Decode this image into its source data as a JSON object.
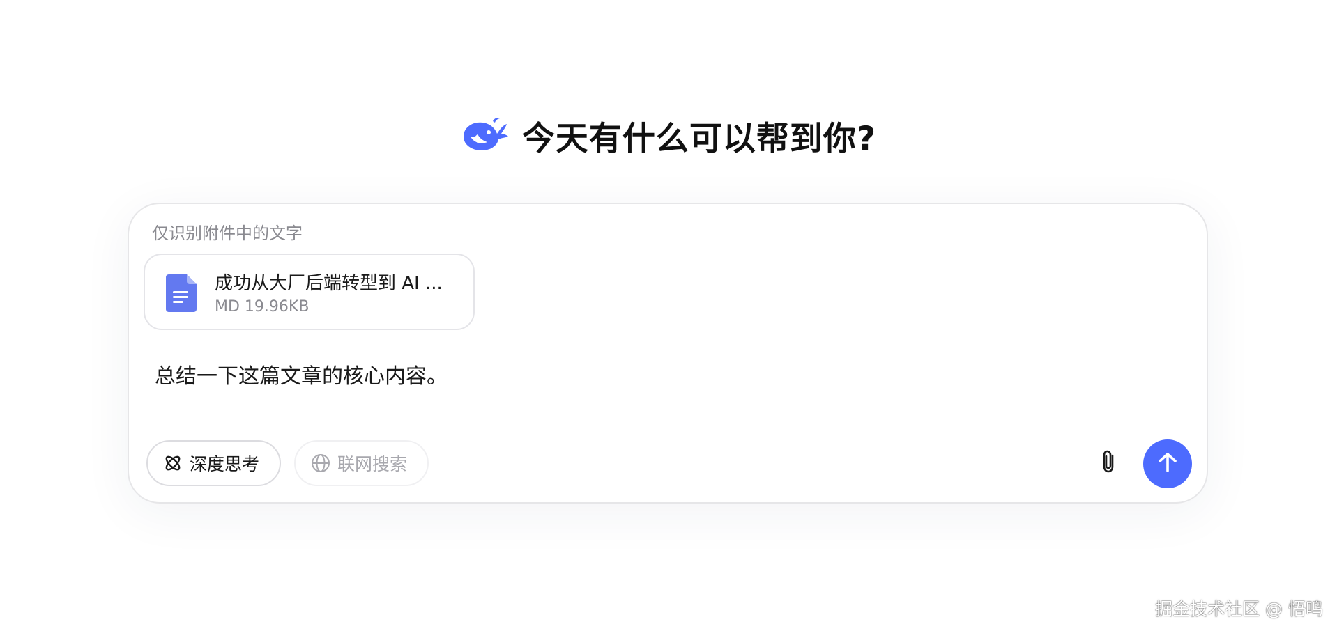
{
  "heading": {
    "title": "今天有什么可以帮到你?",
    "logo_icon": "deepseek-whale-logo"
  },
  "composer": {
    "hint": "仅识别附件中的文字",
    "attachment": {
      "icon": "document-icon",
      "name": "成功从大厂后端转型到 AI ...",
      "meta": "MD 19.96KB"
    },
    "prompt": "总结一下这篇文章的核心内容。",
    "toggles": {
      "deep_think": {
        "label": "深度思考",
        "icon": "atom-icon",
        "active": true
      },
      "web_search": {
        "label": "联网搜索",
        "icon": "globe-icon",
        "active": false
      }
    },
    "attach_icon": "paperclip-icon",
    "send_icon": "arrow-up-icon"
  },
  "watermark": "掘金技术社区 @ 悟鸣",
  "colors": {
    "accent": "#4d6bfe",
    "file_icon": "#6379f0",
    "muted_text": "#8a8a90",
    "border": "#e6e6e8"
  }
}
